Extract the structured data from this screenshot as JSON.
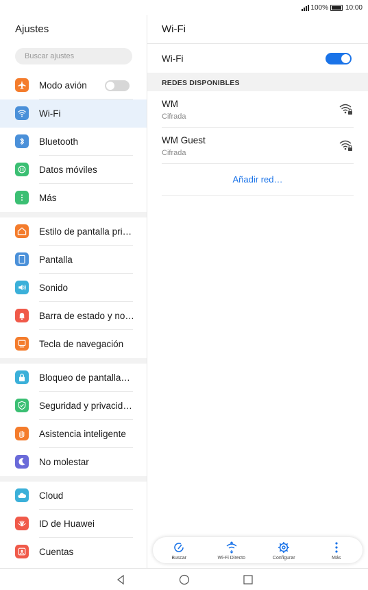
{
  "status_bar": {
    "battery": "100%",
    "time": "10:00"
  },
  "left": {
    "title": "Ajustes",
    "search_placeholder": "Buscar ajustes",
    "groups": [
      [
        {
          "label": "Modo avión",
          "icon": "airplane-icon",
          "color": "#f47c2c"
        },
        {
          "label": "Wi-Fi",
          "icon": "wifi-icon",
          "color": "#4a90d9",
          "selected": true
        },
        {
          "label": "Bluetooth",
          "icon": "bluetooth-icon",
          "color": "#4a90d9"
        },
        {
          "label": "Datos móviles",
          "icon": "mobile-data-icon",
          "color": "#3bbf73"
        },
        {
          "label": "Más",
          "icon": "more-icon",
          "color": "#3bbf73"
        }
      ],
      [
        {
          "label": "Estilo de pantalla pri…",
          "icon": "home-icon",
          "color": "#f47c2c"
        },
        {
          "label": "Pantalla",
          "icon": "display-icon",
          "color": "#4a90d9"
        },
        {
          "label": "Sonido",
          "icon": "sound-icon",
          "color": "#3bb0d9"
        },
        {
          "label": "Barra de estado y no…",
          "icon": "notification-icon",
          "color": "#f05a4a"
        },
        {
          "label": "Tecla de navegación",
          "icon": "navigation-key-icon",
          "color": "#f47c2c"
        }
      ],
      [
        {
          "label": "Bloqueo de pantalla…",
          "icon": "lock-icon",
          "color": "#3bb0d9"
        },
        {
          "label": "Seguridad y privacid…",
          "icon": "shield-icon",
          "color": "#3bbf73"
        },
        {
          "label": "Asistencia inteligente",
          "icon": "hand-icon",
          "color": "#f47c2c"
        },
        {
          "label": "No molestar",
          "icon": "moon-icon",
          "color": "#6a6ad9"
        }
      ],
      [
        {
          "label": "Cloud",
          "icon": "cloud-icon",
          "color": "#3bb0d9"
        },
        {
          "label": "ID de Huawei",
          "icon": "huawei-icon",
          "color": "#f05a4a"
        },
        {
          "label": "Cuentas",
          "icon": "account-icon",
          "color": "#f05a4a"
        }
      ]
    ]
  },
  "right": {
    "title": "Wi-Fi",
    "wifi_label": "Wi-Fi",
    "wifi_on": true,
    "section_header": "REDES DISPONIBLES",
    "networks": [
      {
        "name": "WM",
        "security": "Cifrada"
      },
      {
        "name": "WM Guest",
        "security": "Cifrada"
      }
    ],
    "add_network": "Añadir red…",
    "toolbar": [
      {
        "label": "Buscar",
        "icon": "scan-icon"
      },
      {
        "label": "Wi-Fi Directo",
        "icon": "wifi-direct-icon"
      },
      {
        "label": "Configurar",
        "icon": "gear-icon"
      },
      {
        "label": "Más",
        "icon": "more-vertical-icon"
      }
    ]
  },
  "colors": {
    "accent": "#1a73e8",
    "selected_bg": "#e8f1fb"
  }
}
